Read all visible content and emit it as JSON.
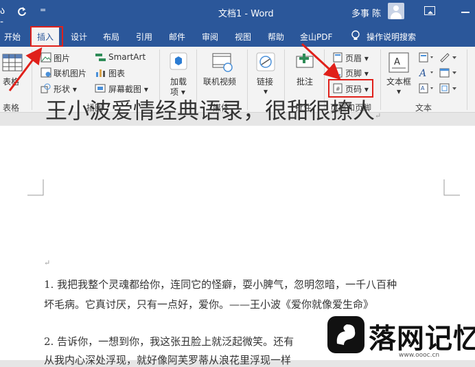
{
  "titlebar": {
    "qat_partial": "ა -",
    "refresh_icon": "redo-icon",
    "dropdown_mark": "=",
    "doc_title": "文档1 - Word",
    "user_name": "多事 陈"
  },
  "tabs": [
    "开始",
    "插入",
    "设计",
    "布局",
    "引用",
    "邮件",
    "审阅",
    "视图",
    "帮助",
    "金山PDF",
    "操作说明搜索"
  ],
  "ribbon": {
    "table_label": "表格",
    "table_group": "表格",
    "illustrations": {
      "picture": "图片",
      "online_picture": "联机图片",
      "shapes": "形状",
      "smartart": "SmartArt",
      "chart": "图表",
      "screenshot": "屏幕截图",
      "group": "插图"
    },
    "addins": {
      "line1": "加载",
      "line2": "项"
    },
    "media": {
      "online_video": "联机视频",
      "group": "媒体"
    },
    "links": {
      "label": "链接"
    },
    "comments": {
      "comment": "批注",
      "group": "批注"
    },
    "header_footer": {
      "header": "页眉",
      "footer": "页脚",
      "page_number": "页码",
      "group": "页眉和页脚"
    },
    "text": {
      "textbox": "文本框",
      "group": "文本"
    }
  },
  "document": {
    "title": "王小波爱情经典语录，很甜很撩人",
    "para1_line1": "1. 我把我整个灵魂都给你，连同它的怪癖，耍小脾气，忽明忽暗，一千八百种",
    "para1_line2": "坏毛病。它真讨厌，只有一点好，爱你。——王小波《爱你就像爱生命》",
    "para2_line1": "2. 告诉你，一想到你，我这张丑脸上就泛起微笑。还有",
    "para2_line2": "从我内心深处浮现，就好像阿芙罗蒂从浪花里浮现一样"
  },
  "watermark": {
    "text": "落网记忆",
    "url": "www.oooc.cn"
  },
  "colors": {
    "accent": "#2b579a",
    "highlight": "#e0201a"
  }
}
